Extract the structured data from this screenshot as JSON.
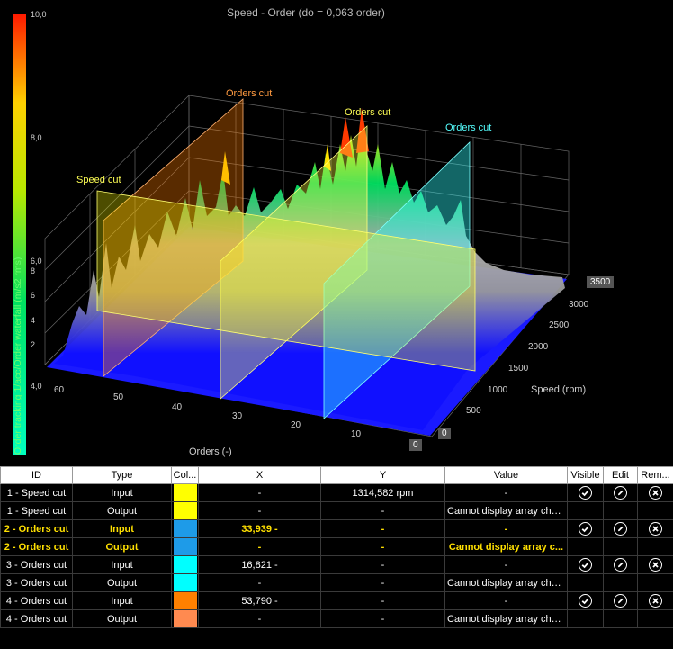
{
  "plot": {
    "title": "Speed - Order (do = 0,063 order)",
    "colorbar": {
      "title": "Order tracking 1/acc/Order waterfall (m/s2 rms)",
      "labels": [
        {
          "text": "10,0",
          "value": 10.0
        },
        {
          "text": "8,0",
          "value": 8.0
        },
        {
          "text": "6,0",
          "value": 6.0
        },
        {
          "text": "4,0",
          "value": 4.0
        }
      ],
      "minor_labels": [
        "8",
        "6",
        "4",
        "2"
      ]
    },
    "orders_axis": {
      "title": "Orders (-)",
      "ticks": [
        "60",
        "50",
        "40",
        "30",
        "20",
        "10",
        "0"
      ]
    },
    "speed_axis": {
      "title": "Speed (rpm)",
      "ticks": [
        "0",
        "500",
        "1000",
        "1500",
        "2000",
        "2500",
        "3000",
        "3500"
      ]
    },
    "cut_labels": [
      {
        "text": "Speed cut",
        "color": "#ffff55"
      },
      {
        "text": "Orders cut",
        "color": "#ff9a40"
      },
      {
        "text": "Orders cut",
        "color": "#ffff55"
      },
      {
        "text": "Orders cut",
        "color": "#55ffff"
      }
    ]
  },
  "table": {
    "headers": [
      "ID",
      "Type",
      "Col...",
      "X",
      "Y",
      "Value",
      "Visible",
      "Edit",
      "Rem..."
    ],
    "rows": [
      {
        "id": "1 - Speed cut",
        "type": "Input",
        "color": "#ffff00",
        "x": "-",
        "y": "1314,582 rpm",
        "value": "-",
        "actions": true,
        "selected": false
      },
      {
        "id": "1 - Speed cut",
        "type": "Output",
        "color": "#ffff00",
        "x": "-",
        "y": "-",
        "value": "Cannot display array chan...",
        "actions": false,
        "selected": false
      },
      {
        "id": "2 - Orders cut",
        "type": "Input",
        "color": "#1e9be8",
        "x": "33,939 -",
        "y": "-",
        "value": "-",
        "actions": true,
        "selected": true
      },
      {
        "id": "2 - Orders cut",
        "type": "Output",
        "color": "#1e9be8",
        "x": "-",
        "y": "-",
        "value": "Cannot display array c...",
        "actions": false,
        "selected": true
      },
      {
        "id": "3 - Orders cut",
        "type": "Input",
        "color": "#00ffff",
        "x": "16,821 -",
        "y": "-",
        "value": "-",
        "actions": true,
        "selected": false
      },
      {
        "id": "3 - Orders cut",
        "type": "Output",
        "color": "#00ffff",
        "x": "-",
        "y": "-",
        "value": "Cannot display array chan...",
        "actions": false,
        "selected": false
      },
      {
        "id": "4 - Orders cut",
        "type": "Input",
        "color": "#ff8000",
        "x": "53,790 -",
        "y": "-",
        "value": "-",
        "actions": true,
        "selected": false
      },
      {
        "id": "4 - Orders cut",
        "type": "Output",
        "color": "#ff8a50",
        "x": "-",
        "y": "-",
        "value": "Cannot display array chan...",
        "actions": false,
        "selected": false
      }
    ]
  }
}
